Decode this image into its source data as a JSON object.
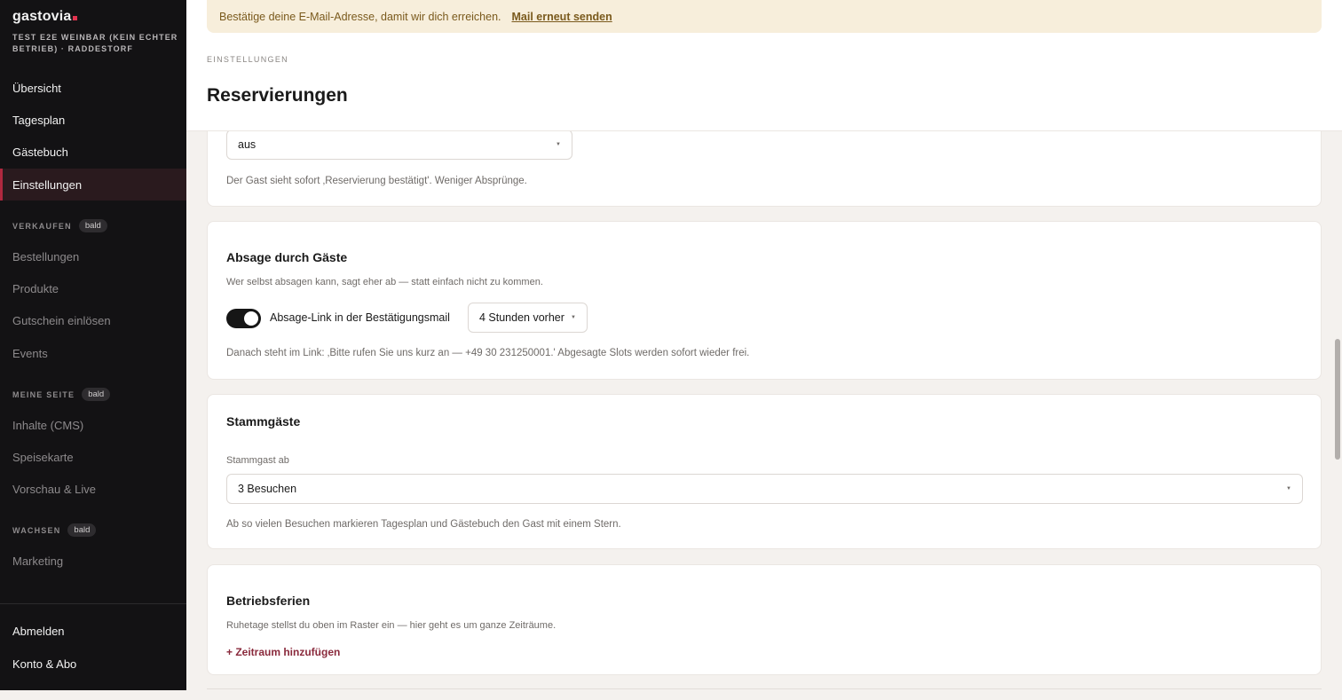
{
  "sidebar": {
    "brand": "gastovia",
    "venue": "TEST E2E WEINBAR (KEIN ECHTER BETRIEB) · RADDESTORF",
    "nav_main": [
      {
        "label": "Übersicht"
      },
      {
        "label": "Tagesplan"
      },
      {
        "label": "Gästebuch"
      },
      {
        "label": "Einstellungen",
        "active": true
      }
    ],
    "sections": [
      {
        "title": "VERKAUFEN",
        "badge": "bald",
        "items": [
          "Bestellungen",
          "Produkte",
          "Gutschein einlösen",
          "Events"
        ]
      },
      {
        "title": "MEINE SEITE",
        "badge": "bald",
        "items": [
          "Inhalte (CMS)",
          "Speisekarte",
          "Vorschau & Live"
        ]
      },
      {
        "title": "WACHSEN",
        "badge": "bald",
        "items": [
          "Marketing"
        ]
      }
    ],
    "footer": [
      "Abmelden",
      "Konto & Abo"
    ]
  },
  "banner": {
    "text": "Bestätige deine E-Mail-Adresse, damit wir dich erreichen.",
    "link": "Mail erneut senden"
  },
  "header": {
    "eyebrow": "EINSTELLUNGEN",
    "title": "Reservierungen"
  },
  "cards": {
    "confirm": {
      "select_value": "aus",
      "hint": "Der Gast sieht sofort ‚Reservierung bestätigt'. Weniger Absprünge."
    },
    "cancel": {
      "title": "Absage durch Gäste",
      "sub": "Wer selbst absagen kann, sagt eher ab — statt einfach nicht zu kommen.",
      "toggle_label": "Absage-Link in der Bestätigungsmail",
      "toggle_on": true,
      "select_value": "4 Stunden vorher",
      "hint": "Danach steht im Link: ‚Bitte rufen Sie uns kurz an — +49 30 231250001.' Abgesagte Slots werden sofort wieder frei."
    },
    "regulars": {
      "title": "Stammgäste",
      "field_label": "Stammgast ab",
      "select_value": "3 Besuchen",
      "hint": "Ab so vielen Besuchen markieren Tagesplan und Gästebuch den Gast mit einem Stern."
    },
    "holidays": {
      "title": "Betriebsferien",
      "sub": "Ruhetage stellst du oben im Raster ein — hier geht es um ganze Zeiträume.",
      "add_link": "+ Zeitraum hinzufügen"
    }
  },
  "colors": {
    "sidebar_bg": "#131214",
    "accent": "#b0283f",
    "banner_bg": "#f7eedb",
    "link": "#8a2a3c"
  },
  "icons": {
    "select_chevron": "chevron-down-icon"
  }
}
